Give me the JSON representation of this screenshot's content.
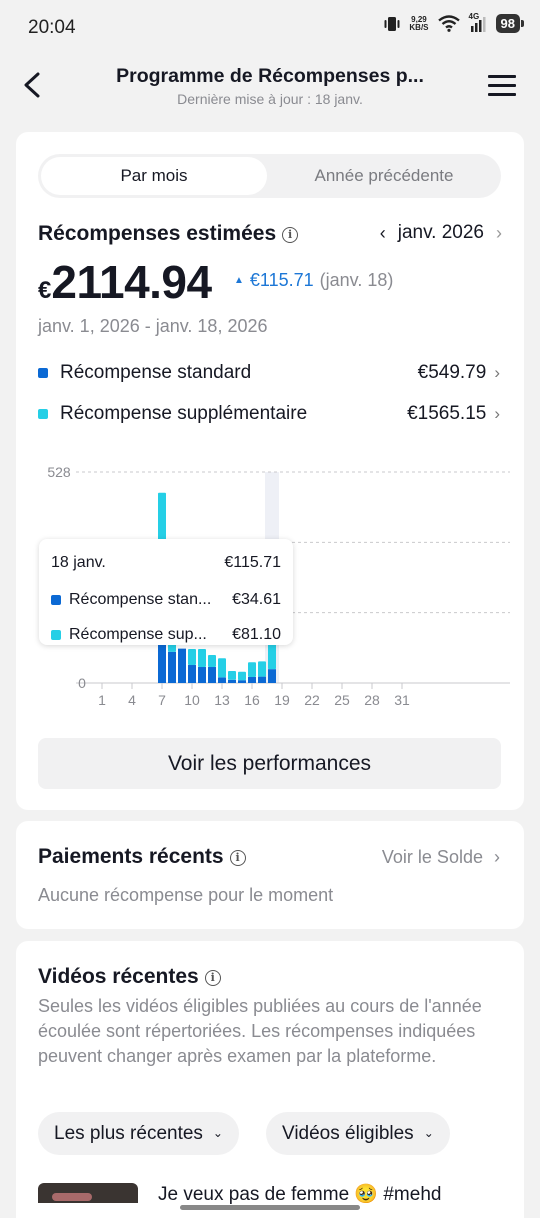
{
  "status_bar": {
    "time": "20:04",
    "net_speed": "9,29",
    "net_unit": "KB/S",
    "network": "4G",
    "battery": "98"
  },
  "nav": {
    "title": "Programme de Récompenses p...",
    "subtitle": "Dernière mise à jour : 18 janv."
  },
  "tabs": {
    "monthly": "Par mois",
    "previous_year": "Année précédente",
    "active": "monthly"
  },
  "rewards": {
    "title": "Récompenses estimées",
    "month": "janv. 2026",
    "currency": "€",
    "amount": "2114.94",
    "delta": "€115.71",
    "delta_date": "(janv. 18)",
    "date_range": "janv. 1, 2026 - janv. 18, 2026",
    "standard_label": "Récompense standard",
    "standard_value": "€549.79",
    "extra_label": "Récompense supplémentaire",
    "extra_value": "€1565.15"
  },
  "colors": {
    "standard": "#0b69d4",
    "extra": "#25cfe6",
    "link_blue": "#1d77d6",
    "highlight": "#eef0f6"
  },
  "chart_data": {
    "type": "bar",
    "stacked": true,
    "x": [
      1,
      2,
      3,
      4,
      5,
      6,
      7,
      8,
      9,
      10,
      11,
      12,
      13,
      14,
      15,
      16,
      17,
      18,
      19,
      20,
      21,
      22,
      23,
      24,
      25,
      26,
      27,
      28,
      29,
      30,
      31
    ],
    "x_tick_labels": [
      "1",
      "4",
      "7",
      "10",
      "13",
      "16",
      "19",
      "22",
      "25",
      "28",
      "31"
    ],
    "y_tick_labels": [
      "528",
      "0"
    ],
    "ylim": [
      0,
      528
    ],
    "series": [
      {
        "name": "Récompense standard",
        "values": [
          0,
          0,
          0,
          0,
          0,
          0,
          96,
          0,
          0,
          0,
          0,
          0,
          0,
          0,
          0,
          0,
          0,
          34.61,
          0,
          0,
          0,
          0,
          0,
          0,
          0,
          0,
          0,
          0,
          0,
          0,
          0
        ]
      },
      {
        "name": "Récompense supplémentaire",
        "values": [
          0,
          0,
          0,
          0,
          0,
          0,
          380,
          0,
          0,
          0,
          0,
          0,
          0,
          0,
          0,
          0,
          0,
          81.1,
          0,
          0,
          0,
          0,
          0,
          0,
          0,
          0,
          0,
          0,
          0,
          0,
          0
        ]
      }
    ],
    "approx_totals_visible": [
      0,
      0,
      0,
      0,
      0,
      0,
      476,
      0,
      0,
      0,
      0,
      0,
      0,
      0,
      0,
      0,
      0,
      115.71,
      0,
      0,
      0,
      0,
      0,
      0,
      0,
      0,
      0,
      0,
      0,
      0,
      0
    ],
    "partial_bars_below_tooltip": [
      {
        "day": 7,
        "standard": 96,
        "extra": 0
      },
      {
        "day": 8,
        "standard": 78,
        "extra": 20
      },
      {
        "day": 9,
        "standard": 86,
        "extra": 0
      },
      {
        "day": 10,
        "standard": 45,
        "extra": 40
      },
      {
        "day": 11,
        "standard": 40,
        "extra": 45
      },
      {
        "day": 12,
        "standard": 40,
        "extra": 30
      },
      {
        "day": 13,
        "standard": 14,
        "extra": 48
      },
      {
        "day": 14,
        "standard": 8,
        "extra": 22
      },
      {
        "day": 15,
        "standard": 7,
        "extra": 21
      },
      {
        "day": 16,
        "standard": 15,
        "extra": 37
      },
      {
        "day": 17,
        "standard": 16,
        "extra": 38
      }
    ],
    "highlighted_day": 18,
    "grid": true
  },
  "tooltip": {
    "date": "18 janv.",
    "total": "€115.71",
    "standard_label": "Récompense stan...",
    "standard_value": "€34.61",
    "extra_label": "Récompense sup...",
    "extra_value": "€81.10"
  },
  "perf_button": "Voir les performances",
  "payments": {
    "title": "Paiements récents",
    "link": "Voir le Solde",
    "empty": "Aucune récompense pour le moment"
  },
  "videos": {
    "title": "Vidéos récentes",
    "description": "Seules les vidéos éligibles publiées au cours de l'année écoulée sont répertoriées. Les récompenses indiquées peuvent changer après examen par la plateforme.",
    "sort_filter": "Les plus récentes",
    "type_filter": "Vidéos éligibles",
    "first_video_title": "Je veux pas de femme 🥹 #mehd"
  }
}
